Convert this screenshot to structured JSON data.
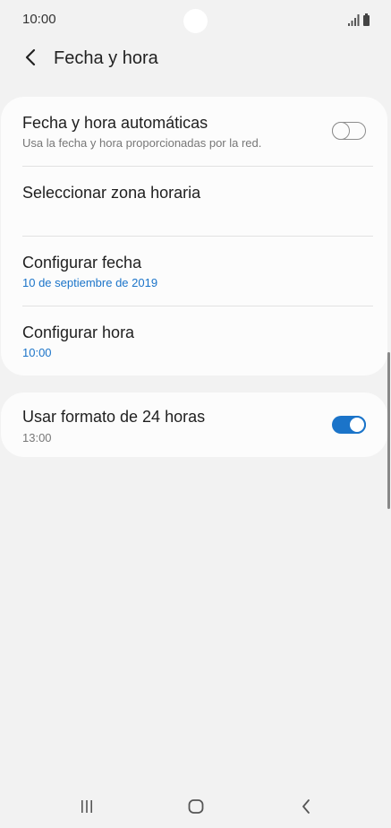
{
  "status_bar": {
    "time": "10:00"
  },
  "app_bar": {
    "title": "Fecha y hora"
  },
  "settings": {
    "automatic": {
      "title": "Fecha y hora automáticas",
      "subtitle": "Usa la fecha y hora proporcionadas por la red.",
      "enabled": false
    },
    "timezone": {
      "title": "Seleccionar zona horaria"
    },
    "set_date": {
      "title": "Configurar fecha",
      "value": "10 de septiembre de 2019"
    },
    "set_time": {
      "title": "Configurar hora",
      "value": "10:00"
    },
    "format_24h": {
      "title": "Usar formato de 24 horas",
      "subtitle": "13:00",
      "enabled": true
    }
  },
  "colors": {
    "accent": "#1b74c9",
    "background": "#f2f2f2",
    "card": "#fcfcfc"
  },
  "icons": {
    "back": "back-arrow-icon",
    "nav_recents": "recent-apps-icon",
    "nav_home": "home-icon",
    "nav_back": "back-icon"
  }
}
